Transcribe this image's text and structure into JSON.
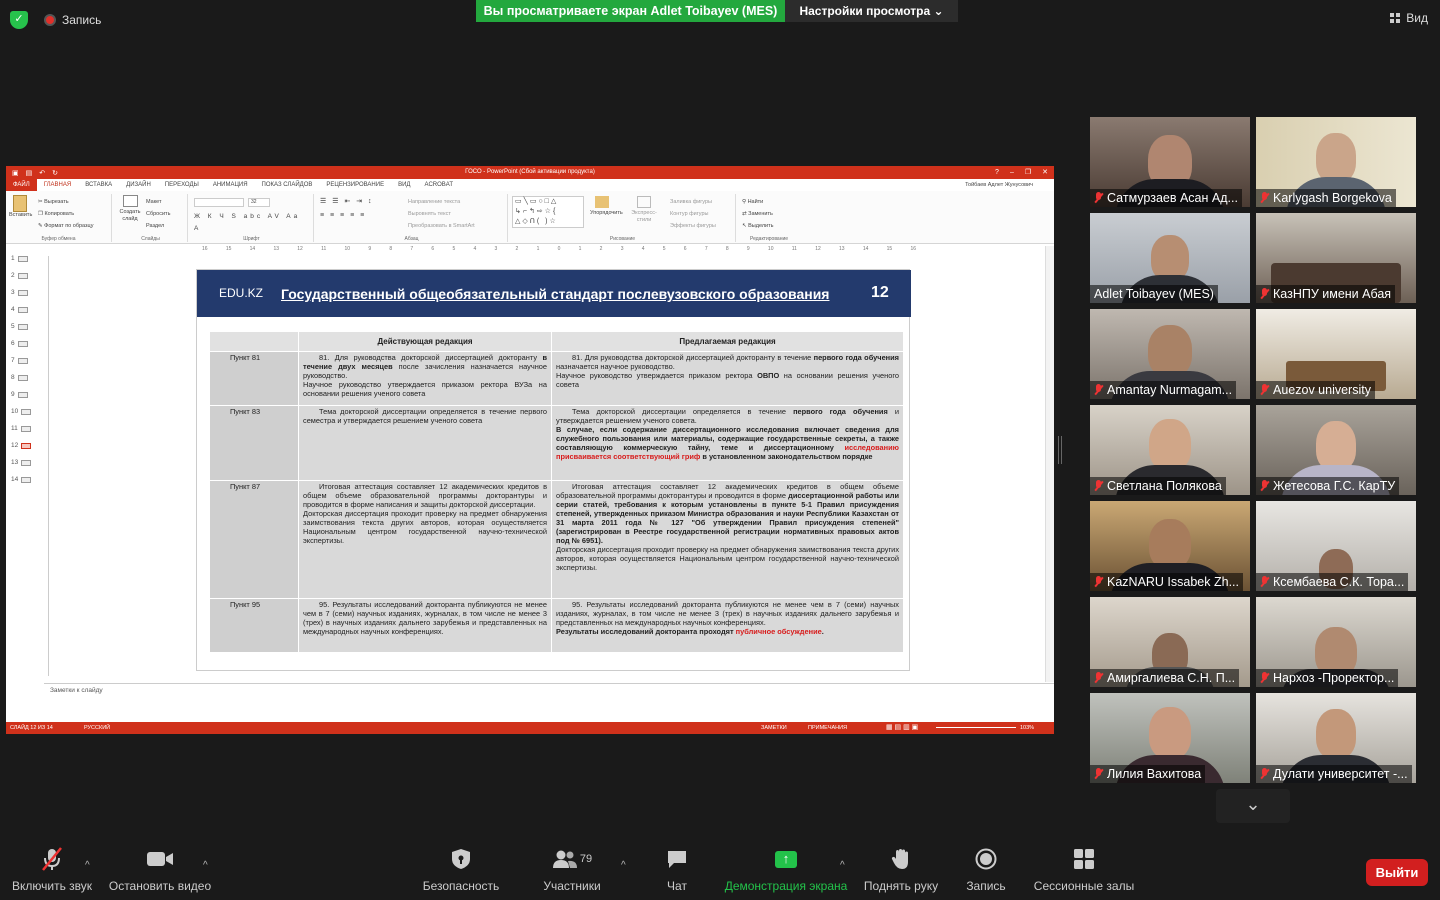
{
  "top": {
    "record": "Запись",
    "banner": "Вы просматриваете экран Adlet Toibayev (MES)",
    "view_options": "Настройки просмотра",
    "view": "Вид"
  },
  "ppt": {
    "window_title": "ГОСО - PowerPoint (Сбой активации продукта)",
    "menu": [
      "ФАЙЛ",
      "ГЛАВНАЯ",
      "ВСТАВКА",
      "ДИЗАЙН",
      "ПЕРЕХОДЫ",
      "АНИМАЦИЯ",
      "ПОКАЗ СЛАЙДОВ",
      "РЕЦЕНЗИРОВАНИЕ",
      "ВИД",
      "ACROBAT"
    ],
    "user": "Тойбаев Адлет Жунусович",
    "ribbon": {
      "clipboard": {
        "paste": "Вставить",
        "cut": "Вырезать",
        "copy": "Копировать",
        "format": "Формат по образцу",
        "name": "Буфер обмена"
      },
      "slides": {
        "new": "Создать слайд",
        "layout": "Макет",
        "reset": "Сбросить",
        "section": "Раздел",
        "name": "Слайды"
      },
      "font": {
        "size": "32",
        "name": "Шрифт"
      },
      "paragraph": {
        "dir": "Направление текста",
        "align": "Выровнять текст",
        "smartart": "Преобразовать в SmartArt",
        "name": "Абзац"
      },
      "drawing": {
        "arrange": "Упорядочить",
        "styles": "Экспресс-стили",
        "fill": "Заливка фигуры",
        "outline": "Контур фигуры",
        "effects": "Эффекты фигуры",
        "name": "Рисование"
      },
      "editing": {
        "find": "Найти",
        "replace": "Заменить",
        "select": "Выделить",
        "name": "Редактирование"
      }
    },
    "ruler": [
      "16",
      "15",
      "14",
      "13",
      "12",
      "11",
      "10",
      "9",
      "8",
      "7",
      "6",
      "5",
      "4",
      "3",
      "2",
      "1",
      "0",
      "1",
      "2",
      "3",
      "4",
      "5",
      "6",
      "7",
      "8",
      "9",
      "10",
      "11",
      "12",
      "13",
      "14",
      "15",
      "16"
    ],
    "thumbs": [
      "1",
      "2",
      "3",
      "4",
      "5",
      "6",
      "7",
      "8",
      "9",
      "10",
      "11",
      "12",
      "13",
      "14"
    ],
    "slide": {
      "brand": "EDU.KZ",
      "title": "Государственный общеобязательный стандарт послевузовского образования",
      "page": "12",
      "col_current": "Действующая редакция",
      "col_proposed": "Предлагаемая редакция",
      "rows": [
        {
          "label": "Пункт 81"
        },
        {
          "label": "Пункт 83"
        },
        {
          "label": "Пункт 87"
        },
        {
          "label": "Пункт 95"
        }
      ]
    },
    "notes": "Заметки к слайду",
    "status": {
      "slide": "СЛАЙД 12 ИЗ 14",
      "lang": "РУССКИЙ",
      "notes": "ЗАМЕТКИ",
      "comments": "ПРИМЕЧАНИЯ",
      "zoom": "103%"
    }
  },
  "participants": [
    "Сатмурзаев Асан Ад...",
    "Karlygash Borgekova",
    "Adlet Toibayev (MES)",
    "КазНПУ имени Абая",
    "Amantay Nurmagam...",
    "Auezov university",
    "Светлана Полякова",
    "Жетесова Г.С. КарТУ",
    "KazNARU Issabek Zh...",
    "Ксембаева С.К. Тора...",
    "Амиргалиева С.Н.  П...",
    "Нархоз  -Проректор...",
    "Лилия Вахитова",
    "Дулати университет -..."
  ],
  "toolbar": {
    "mute": "Включить звук",
    "video": "Остановить видео",
    "security": "Безопасность",
    "participants": "Участники",
    "participants_count": "79",
    "chat": "Чат",
    "share": "Демонстрация экрана",
    "raise": "Поднять руку",
    "record": "Запись",
    "breakout": "Сессионные залы",
    "leave": "Выйти"
  },
  "colors": {
    "accent_green": "#23a83e",
    "ppt_red": "#d0311b",
    "slide_header": "#233a6d",
    "leave_red": "#d21f1f",
    "active_speaker": "#d3e25a"
  }
}
